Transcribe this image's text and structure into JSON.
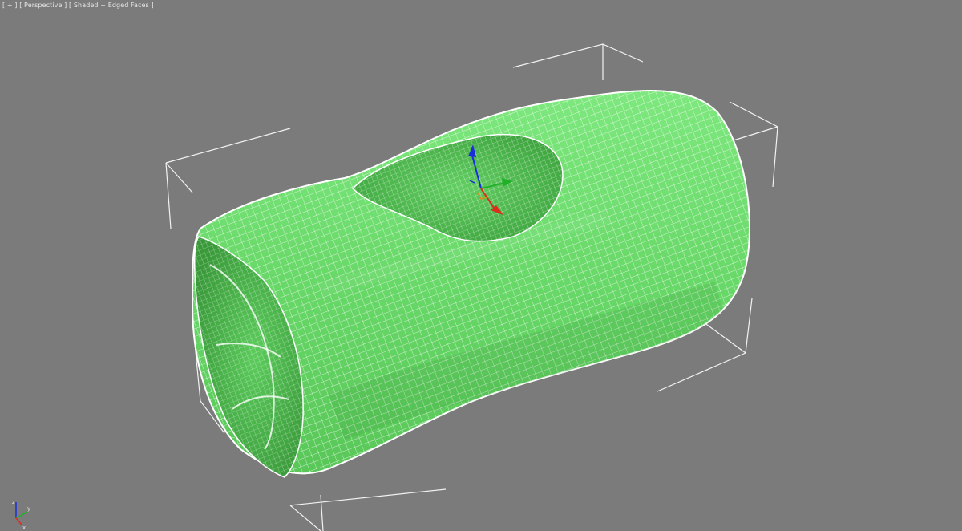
{
  "viewport": {
    "menu_plus": "[ + ]",
    "view_name": "[ Perspective ]",
    "shading_mode": "[ Shaded + Edged Faces ]",
    "background_color": "#7b7b7b",
    "object_color": "#6fe06f",
    "object_dark_color": "#4fba4f",
    "wire_color": "#ffffff",
    "bbox_color": "#f2f2f2"
  },
  "gizmo": {
    "x_color": "#e02a1a",
    "y_color": "#22b02a",
    "z_color": "#1b2fd8"
  },
  "axis_tripod": {
    "x_label": "x",
    "y_label": "y",
    "z_label": "z"
  }
}
